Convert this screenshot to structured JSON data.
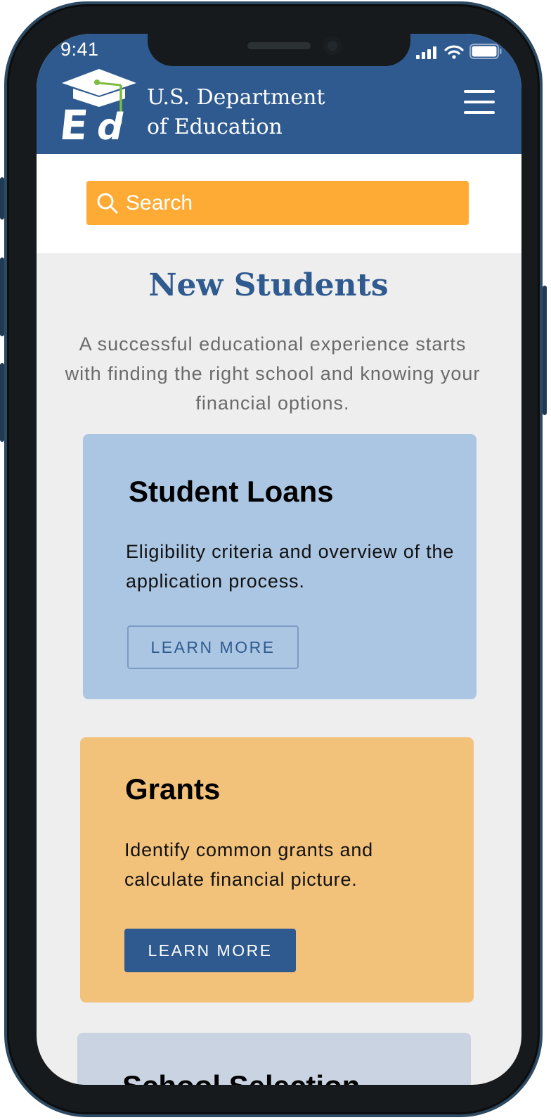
{
  "status_bar": {
    "time": "9:41"
  },
  "header": {
    "brand_line1": "U.S. Department",
    "brand_line2": "of Education",
    "logo_letters": "Ed",
    "background": "#2f5a8f"
  },
  "search": {
    "label": "Search",
    "color": "#fdab35"
  },
  "hero": {
    "title": "New Students",
    "description": "A successful educational experience starts with finding the right school and knowing your financial options."
  },
  "cards": [
    {
      "title": "Student Loans",
      "description": "Eligibility criteria and overview of the application process.",
      "button_label": "LEARN MORE",
      "color": "#abc6e3"
    },
    {
      "title": "Grants",
      "description": "Identify common grants and calculate financial picture.",
      "button_label": "LEARN MORE",
      "color": "#f3c27a"
    },
    {
      "title": "School Selection",
      "color": "#cad3e2"
    }
  ],
  "icons": {
    "menu": "hamburger-menu-icon",
    "search": "search-icon",
    "signal": "cellular-signal-icon",
    "wifi": "wifi-icon",
    "battery": "battery-icon"
  }
}
